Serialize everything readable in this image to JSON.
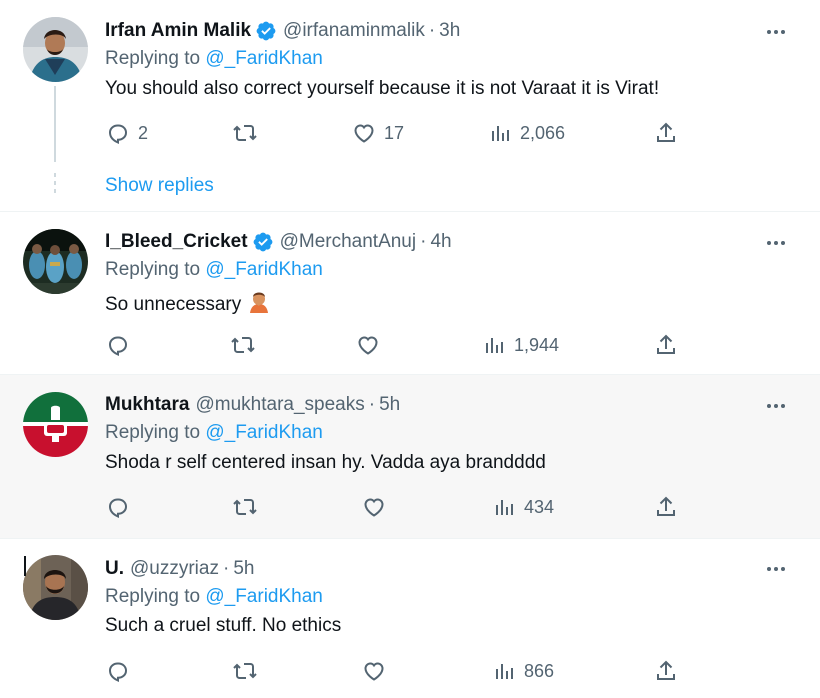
{
  "reply_prefix": "Replying to ",
  "colors": {
    "accent": "#1d9bf0",
    "secondary_text": "#536471",
    "highlight_bg": "#f7f7f7"
  },
  "icons": {
    "reply": "reply-icon",
    "retweet": "retweet-icon",
    "like": "heart-icon",
    "views": "views-icon",
    "share": "share-icon",
    "more": "more-icon",
    "verified": "verified-badge-icon"
  },
  "thread": {
    "show_replies": "Show replies"
  },
  "tweets": [
    {
      "name": "Irfan Amin Malik",
      "verified": true,
      "handle": "@irfanaminmalik",
      "sep": "·",
      "time": "3h",
      "replying_to": "@_FaridKhan",
      "text": "You should also correct yourself because it is not Varaat it is Virat!",
      "replies": "2",
      "retweets": "",
      "likes": "17",
      "views": "2,066"
    },
    {
      "name": "I_Bleed_Cricket",
      "verified": true,
      "handle": "@MerchantAnuj",
      "sep": "·",
      "time": "4h",
      "replying_to": "@_FaridKhan",
      "text": "So unnecessary",
      "emoji": "facepalm",
      "replies": "",
      "retweets": "",
      "likes": "",
      "views": "1,944"
    },
    {
      "name": "Mukhtara",
      "verified": false,
      "handle": "@mukhtara_speaks",
      "sep": "·",
      "time": "5h",
      "replying_to": "@_FaridKhan",
      "text": "Shoda r self centered insan hy. Vadda aya brandddd",
      "replies": "",
      "retweets": "",
      "likes": "",
      "views": "434"
    },
    {
      "name": "U.",
      "verified": false,
      "handle": "@uzzyriaz",
      "sep": "·",
      "time": "5h",
      "replying_to": "@_FaridKhan",
      "text": "Such a cruel stuff. No ethics",
      "replies": "",
      "retweets": "",
      "likes": "",
      "views": "866"
    }
  ]
}
